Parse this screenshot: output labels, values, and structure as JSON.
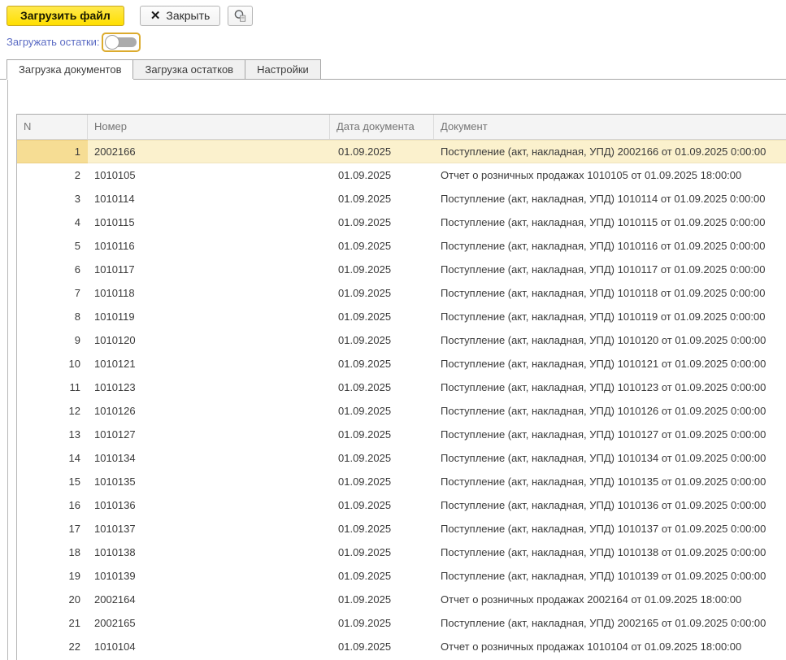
{
  "toolbar": {
    "load_file": "Загрузить файл",
    "close": "Закрыть",
    "close_icon": "✕"
  },
  "toggle": {
    "label": "Загружать остатки:",
    "state": "off"
  },
  "tabs": [
    {
      "label": "Загрузка документов",
      "active": true
    },
    {
      "label": "Загрузка остатков",
      "active": false
    },
    {
      "label": "Настройки",
      "active": false
    }
  ],
  "colors": {
    "primary_button": "#ffdf00",
    "primary_button_border": "#c7a61d",
    "link_blue": "#5b6bc4",
    "focus_frame": "#dcab2e",
    "selected_row": "#fbf1cd",
    "selected_cell": "#f6dd94",
    "header_bg": "#f4f4f4"
  },
  "table": {
    "columns": [
      "N",
      "Номер",
      "Дата документа",
      "Документ"
    ],
    "selected_row": 0,
    "rows": [
      [
        "1",
        "2002166",
        "01.09.2025",
        "Поступление (акт, накладная, УПД) 2002166 от 01.09.2025 0:00:00"
      ],
      [
        "2",
        "1010105",
        "01.09.2025",
        "Отчет о розничных продажах 1010105 от 01.09.2025 18:00:00"
      ],
      [
        "3",
        "1010114",
        "01.09.2025",
        "Поступление (акт, накладная, УПД) 1010114 от 01.09.2025 0:00:00"
      ],
      [
        "4",
        "1010115",
        "01.09.2025",
        "Поступление (акт, накладная, УПД) 1010115 от 01.09.2025 0:00:00"
      ],
      [
        "5",
        "1010116",
        "01.09.2025",
        "Поступление (акт, накладная, УПД) 1010116 от 01.09.2025 0:00:00"
      ],
      [
        "6",
        "1010117",
        "01.09.2025",
        "Поступление (акт, накладная, УПД) 1010117 от 01.09.2025 0:00:00"
      ],
      [
        "7",
        "1010118",
        "01.09.2025",
        "Поступление (акт, накладная, УПД) 1010118 от 01.09.2025 0:00:00"
      ],
      [
        "8",
        "1010119",
        "01.09.2025",
        "Поступление (акт, накладная, УПД) 1010119 от 01.09.2025 0:00:00"
      ],
      [
        "9",
        "1010120",
        "01.09.2025",
        "Поступление (акт, накладная, УПД) 1010120 от 01.09.2025 0:00:00"
      ],
      [
        "10",
        "1010121",
        "01.09.2025",
        "Поступление (акт, накладная, УПД) 1010121 от 01.09.2025 0:00:00"
      ],
      [
        "11",
        "1010123",
        "01.09.2025",
        "Поступление (акт, накладная, УПД) 1010123 от 01.09.2025 0:00:00"
      ],
      [
        "12",
        "1010126",
        "01.09.2025",
        "Поступление (акт, накладная, УПД) 1010126 от 01.09.2025 0:00:00"
      ],
      [
        "13",
        "1010127",
        "01.09.2025",
        "Поступление (акт, накладная, УПД) 1010127 от 01.09.2025 0:00:00"
      ],
      [
        "14",
        "1010134",
        "01.09.2025",
        "Поступление (акт, накладная, УПД) 1010134 от 01.09.2025 0:00:00"
      ],
      [
        "15",
        "1010135",
        "01.09.2025",
        "Поступление (акт, накладная, УПД) 1010135 от 01.09.2025 0:00:00"
      ],
      [
        "16",
        "1010136",
        "01.09.2025",
        "Поступление (акт, накладная, УПД) 1010136 от 01.09.2025 0:00:00"
      ],
      [
        "17",
        "1010137",
        "01.09.2025",
        "Поступление (акт, накладная, УПД) 1010137 от 01.09.2025 0:00:00"
      ],
      [
        "18",
        "1010138",
        "01.09.2025",
        "Поступление (акт, накладная, УПД) 1010138 от 01.09.2025 0:00:00"
      ],
      [
        "19",
        "1010139",
        "01.09.2025",
        "Поступление (акт, накладная, УПД) 1010139 от 01.09.2025 0:00:00"
      ],
      [
        "20",
        "2002164",
        "01.09.2025",
        "Отчет о розничных продажах 2002164 от 01.09.2025 18:00:00"
      ],
      [
        "21",
        "2002165",
        "01.09.2025",
        "Поступление (акт, накладная, УПД) 2002165 от 01.09.2025 0:00:00"
      ],
      [
        "22",
        "1010104",
        "01.09.2025",
        "Отчет о розничных продажах 1010104 от 01.09.2025 18:00:00"
      ]
    ]
  }
}
